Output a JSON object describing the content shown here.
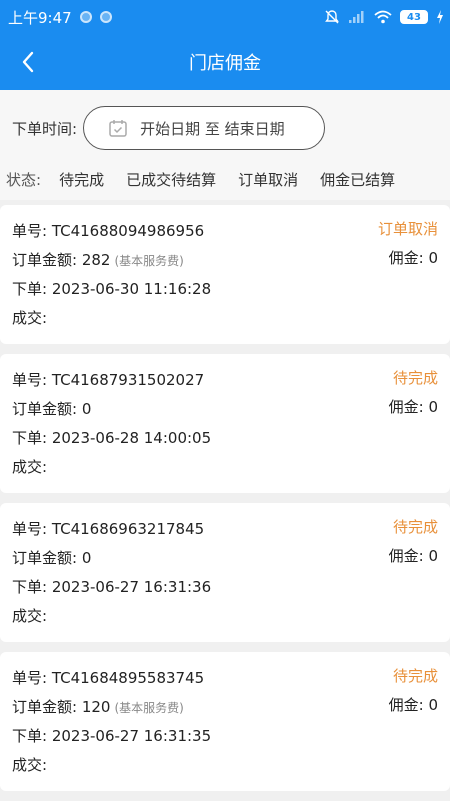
{
  "status_bar": {
    "time": "上午9:47",
    "battery": "43"
  },
  "header": {
    "title": "门店佣金"
  },
  "filter": {
    "date_label": "下单时间:",
    "date_range": "开始日期 至  结束日期",
    "status_label": "状态:",
    "tabs": [
      "待完成",
      "已成交待结算",
      "订单取消",
      "佣金已结算"
    ]
  },
  "orders": [
    {
      "order_no": "单号: TC41688094986956",
      "amount": "订单金额: 282",
      "amount_note": "(基本服务费)",
      "ordered_at": "下单: 2023-06-30 11:16:28",
      "closed_at": "成交:",
      "status": "订单取消",
      "commission": "佣金: 0"
    },
    {
      "order_no": "单号: TC41687931502027",
      "amount": "订单金额: 0",
      "amount_note": "",
      "ordered_at": "下单: 2023-06-28 14:00:05",
      "closed_at": "成交:",
      "status": "待完成",
      "commission": "佣金: 0"
    },
    {
      "order_no": "单号: TC41686963217845",
      "amount": "订单金额: 0",
      "amount_note": "",
      "ordered_at": "下单: 2023-06-27 16:31:36",
      "closed_at": "成交:",
      "status": "待完成",
      "commission": "佣金: 0"
    },
    {
      "order_no": "单号: TC41684895583745",
      "amount": "订单金额: 120",
      "amount_note": "(基本服务费)",
      "ordered_at": "下单: 2023-06-27 16:31:35",
      "closed_at": "成交:",
      "status": "待完成",
      "commission": "佣金: 0"
    }
  ]
}
